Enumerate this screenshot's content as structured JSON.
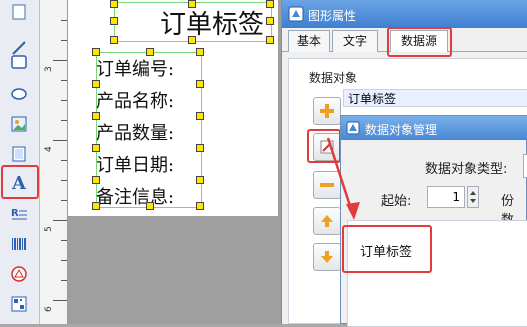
{
  "canvas": {
    "title_text": "订单标签",
    "fields": [
      "订单编号:",
      "产品名称:",
      "产品数量:",
      "订单日期:",
      "备注信息:"
    ]
  },
  "ruler": {
    "labels": [
      "3",
      "4",
      "5",
      "6"
    ]
  },
  "dialog": {
    "title": "图形属性",
    "tabs": [
      "基本",
      "文字",
      "数据源"
    ],
    "active_tab": "数据源",
    "data_object_label": "数据对象",
    "data_object_value": "订单标签"
  },
  "inner_dialog": {
    "title": "数据对象管理",
    "type_label": "数据对象类型:",
    "start_label": "起始:",
    "start_value": "1",
    "share_label": "份数",
    "list_item": "订单标签"
  },
  "colors": {
    "highlight": "#e23b3b",
    "handle": "#ffe600",
    "titlebar": "#4a88d4"
  }
}
